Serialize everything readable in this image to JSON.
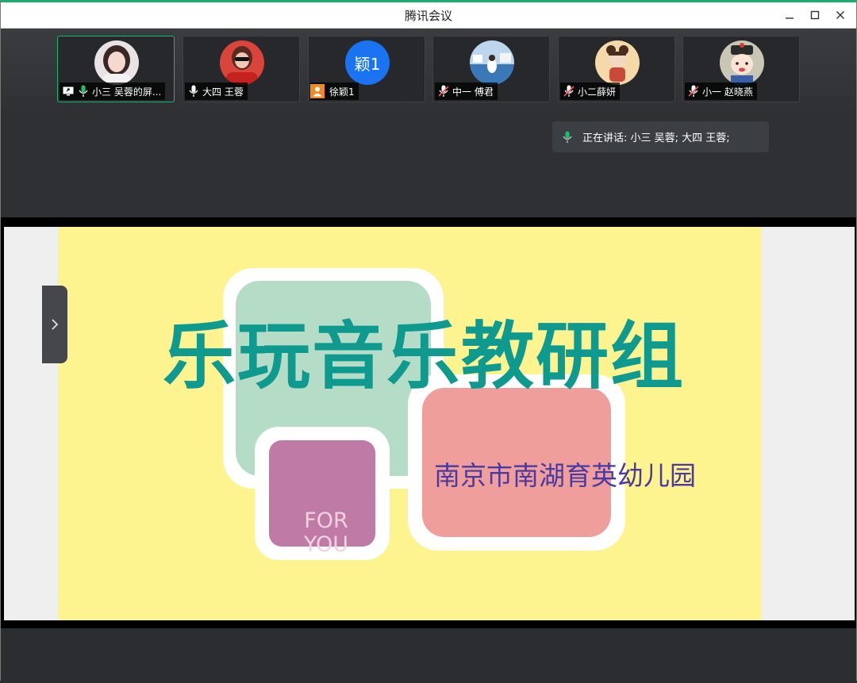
{
  "window": {
    "title": "腾讯会议"
  },
  "participants": [
    {
      "name": "小三 吴蓉的屏...",
      "avatar_kind": "photo-woman-white",
      "status": "screen-sharing-mic-on",
      "active": true
    },
    {
      "name": "大四 王蓉",
      "avatar_kind": "photo-woman-red",
      "status": "mic-on"
    },
    {
      "name": "徐颖1",
      "avatar_text": "颖1",
      "avatar_kind": "text",
      "status": "person"
    },
    {
      "name": "中一 傅君",
      "avatar_kind": "photo-seaside",
      "status": "mic-muted"
    },
    {
      "name": "小二薛妍",
      "avatar_kind": "cartoon-girl",
      "status": "mic-muted"
    },
    {
      "name": "小一 赵晓燕",
      "avatar_kind": "cartoon-qing",
      "status": "mic-muted"
    }
  ],
  "speaking": {
    "label": "正在讲话: 小三 吴蓉; 大四 王蓉;"
  },
  "slide": {
    "title": "乐玩音乐教研组",
    "subtitle": "南京市南湖育英幼儿园",
    "badge_line1": "FOR",
    "badge_line2": "YOU"
  },
  "colors": {
    "accent_green": "#18b675",
    "slide_background": "#fdf38f",
    "title_teal": "#0e9a8e",
    "card_green": "#b5dcc6",
    "card_pink": "#ef9e9c",
    "card_purple": "#c07aa6",
    "subtitle_purple": "#4a3aa0"
  },
  "icons": [
    "minimize-icon",
    "maximize-icon",
    "close-icon",
    "screen-share-icon",
    "mic-icon",
    "mic-muted-icon",
    "person-icon",
    "chevron-right-icon"
  ]
}
